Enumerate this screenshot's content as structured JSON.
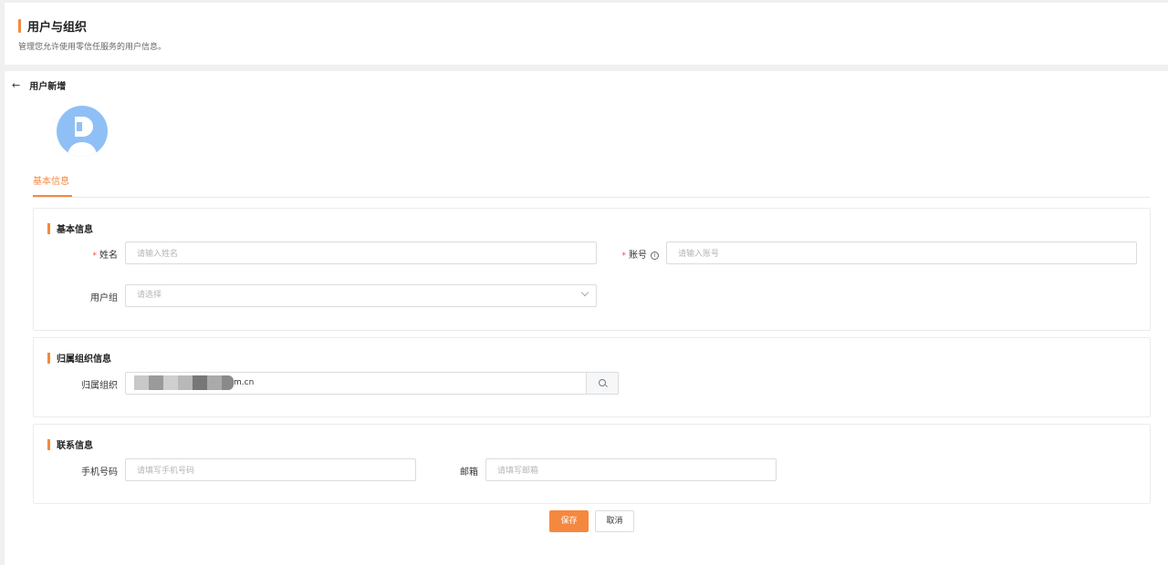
{
  "header": {
    "title": "用户与组织",
    "description": "管理您允许使用零信任服务的用户信息。"
  },
  "subpage": {
    "back_icon": "arrow-left-icon",
    "back_glyph": "←",
    "title": "用户新增"
  },
  "tabs": [
    {
      "label": "基本信息",
      "active": true
    }
  ],
  "sections": {
    "basic": {
      "title": "基本信息",
      "name_label": "姓名",
      "name_placeholder": "请输入姓名",
      "account_label": "账号",
      "account_placeholder": "请输入账号",
      "group_label": "用户组",
      "group_placeholder": "请选择"
    },
    "org": {
      "title": "归属组织信息",
      "org_label": "归属组织",
      "org_value_suffix": "m.cn"
    },
    "contact": {
      "title": "联系信息",
      "phone_label": "手机号码",
      "phone_placeholder": "请填写手机号码",
      "email_label": "邮箱",
      "email_placeholder": "请填写邮箱"
    }
  },
  "actions": {
    "save": "保存",
    "cancel": "取消"
  },
  "symbols": {
    "required": "*",
    "info": "i"
  },
  "colors": {
    "accent": "#f5883f",
    "avatar": "#8fc0f5",
    "required": "#f5483f"
  }
}
